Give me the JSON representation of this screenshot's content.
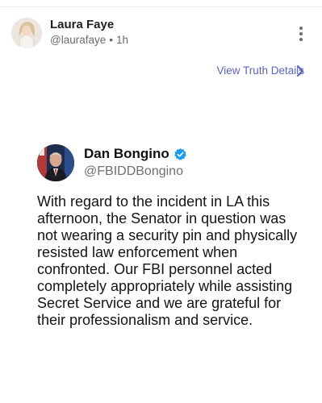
{
  "post": {
    "author_name": "Laura Faye",
    "author_handle": "@laurafaye",
    "separator": "•",
    "time": "1h",
    "details_link": "View Truth Details",
    "icons": {
      "more": "more-vertical-icon",
      "chevron": "chevron-right-icon"
    },
    "colors": {
      "link": "#5a63c9"
    }
  },
  "embed": {
    "author_name": "Dan Bongino",
    "author_handle": "@FBIDDBongino",
    "verified_icon": "verified-badge-icon",
    "verified_color": "#1d9bf0",
    "text": "With regard to the incident in LA this afternoon, the Senator in question was not wearing a security pin and physically resisted law enforcement when confronted. Our FBI personnel acted completely appropriately while assisting Secret Service and we are grateful for their professionalism and service."
  }
}
